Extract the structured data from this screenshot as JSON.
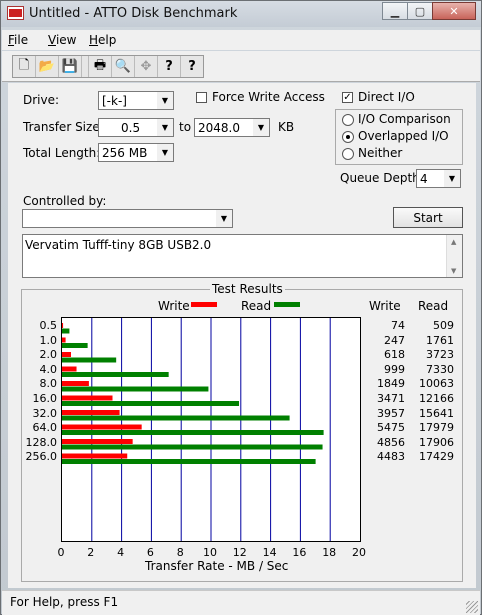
{
  "window": {
    "title": "Untitled - ATTO Disk Benchmark"
  },
  "menu": [
    {
      "label": "File",
      "mnemonic": "F",
      "rest": "ile"
    },
    {
      "label": "View",
      "mnemonic": "V",
      "rest": "iew"
    },
    {
      "label": "Help",
      "mnemonic": "H",
      "rest": "elp"
    }
  ],
  "toolbar": {
    "icons": [
      "new-icon",
      "open-icon",
      "save-icon",
      "print-icon",
      "print-preview-icon",
      "move-icon",
      "help-icon",
      "context-help-icon"
    ],
    "glyphs": [
      "🗋",
      "📂",
      "💾",
      "🖶",
      "🔍",
      "✥",
      "?",
      "?"
    ]
  },
  "form": {
    "drive_label": "Drive:",
    "drive_value": "[-k-]",
    "force_write_label": "Force Write Access",
    "force_write_checked": false,
    "direct_io_label": "Direct I/O",
    "direct_io_checked": true,
    "transfer_size_label": "Transfer Size:",
    "transfer_from": "0.5",
    "to_label": "to",
    "transfer_to": "2048.0",
    "kb_label": "KB",
    "total_length_label": "Total Length:",
    "total_length_value": "256 MB",
    "io_comparison_label": "I/O Comparison",
    "overlapped_io_label": "Overlapped I/O",
    "neither_label": "Neither",
    "selected_mode": "Overlapped I/O",
    "queue_depth_label": "Queue Depth:",
    "queue_depth_value": "4",
    "controlled_by_label": "Controlled by:",
    "controlled_by_value": "",
    "start_label": "Start",
    "description": "Vervatim Tufff-tiny 8GB USB2.0"
  },
  "results": {
    "title": "Test Results",
    "write_legend": "Write",
    "read_legend": "Read",
    "write_col": "Write",
    "read_col": "Read",
    "xlabel": "Transfer Rate - MB / Sec"
  },
  "colors": {
    "write": "#ff0000",
    "read": "#008000",
    "grid": "#0000a0"
  },
  "chart_data": {
    "type": "bar",
    "orientation": "horizontal",
    "title": "Test Results",
    "xlabel": "Transfer Rate - MB / Sec",
    "xlim": [
      0,
      20
    ],
    "xticks": [
      "0",
      "2",
      "4",
      "6",
      "8",
      "10",
      "12",
      "14",
      "16",
      "18",
      "20"
    ],
    "categories": [
      "0.5",
      "1.0",
      "2.0",
      "4.0",
      "8.0",
      "16.0",
      "32.0",
      "64.0",
      "128.0",
      "256.0"
    ],
    "series": [
      {
        "name": "Write",
        "values": [
          74,
          247,
          618,
          999,
          1849,
          3471,
          3957,
          5475,
          4856,
          4483
        ],
        "values_text": [
          "74",
          "247",
          "618",
          "999",
          "1849",
          "3471",
          "3957",
          "5475",
          "4856",
          "4483"
        ]
      },
      {
        "name": "Read",
        "values": [
          509,
          1761,
          3723,
          7330,
          10063,
          12166,
          15641,
          17979,
          17906,
          17429
        ],
        "values_text": [
          "509",
          "1761",
          "3723",
          "7330",
          "10063",
          "12166",
          "15641",
          "17979",
          "17906",
          "17429"
        ]
      }
    ]
  },
  "status": {
    "text": "For Help, press F1"
  }
}
